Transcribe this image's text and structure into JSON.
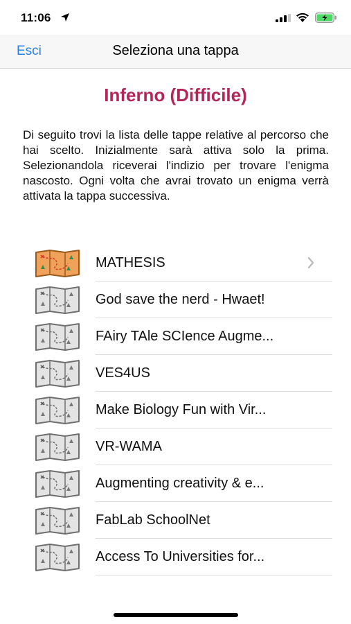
{
  "status_bar": {
    "time": "11:06",
    "icons": [
      "location-arrow-icon",
      "signal-icon",
      "wifi-icon",
      "battery-charging-icon"
    ]
  },
  "navbar": {
    "back_label": "Esci",
    "title": "Seleziona una tappa"
  },
  "heading": "Inferno (Difficile)",
  "description": "Di seguito trovi la lista delle tappe relative al percorso che hai scelto. Inizialmente sarà attiva solo la prima. Selezionandola riceverai l'indizio per trovare l'enigma nascosto. Ogni volta che avrai trovato un enigma verrà attivata la tappa successiva.",
  "colors": {
    "accent": "#2a7ee8",
    "heading": "#b22757",
    "map_active": "#f0a25a",
    "map_inactive": "#e3e3e3"
  },
  "stages": [
    {
      "label": "MATHESIS",
      "active": true,
      "icon": "map-icon",
      "chevron": "chevron-right-icon"
    },
    {
      "label": "God save the nerd - Hwaet!",
      "active": false,
      "icon": "map-icon"
    },
    {
      "label": "FAiry TAle SCIence Augme...",
      "active": false,
      "icon": "map-icon"
    },
    {
      "label": "VES4US",
      "active": false,
      "icon": "map-icon"
    },
    {
      "label": "Make Biology Fun with Vir...",
      "active": false,
      "icon": "map-icon"
    },
    {
      "label": "VR-WAMA",
      "active": false,
      "icon": "map-icon"
    },
    {
      "label": "Augmenting creativity & e...",
      "active": false,
      "icon": "map-icon"
    },
    {
      "label": "FabLab SchoolNet",
      "active": false,
      "icon": "map-icon"
    },
    {
      "label": "Access To Universities for...",
      "active": false,
      "icon": "map-icon"
    }
  ]
}
